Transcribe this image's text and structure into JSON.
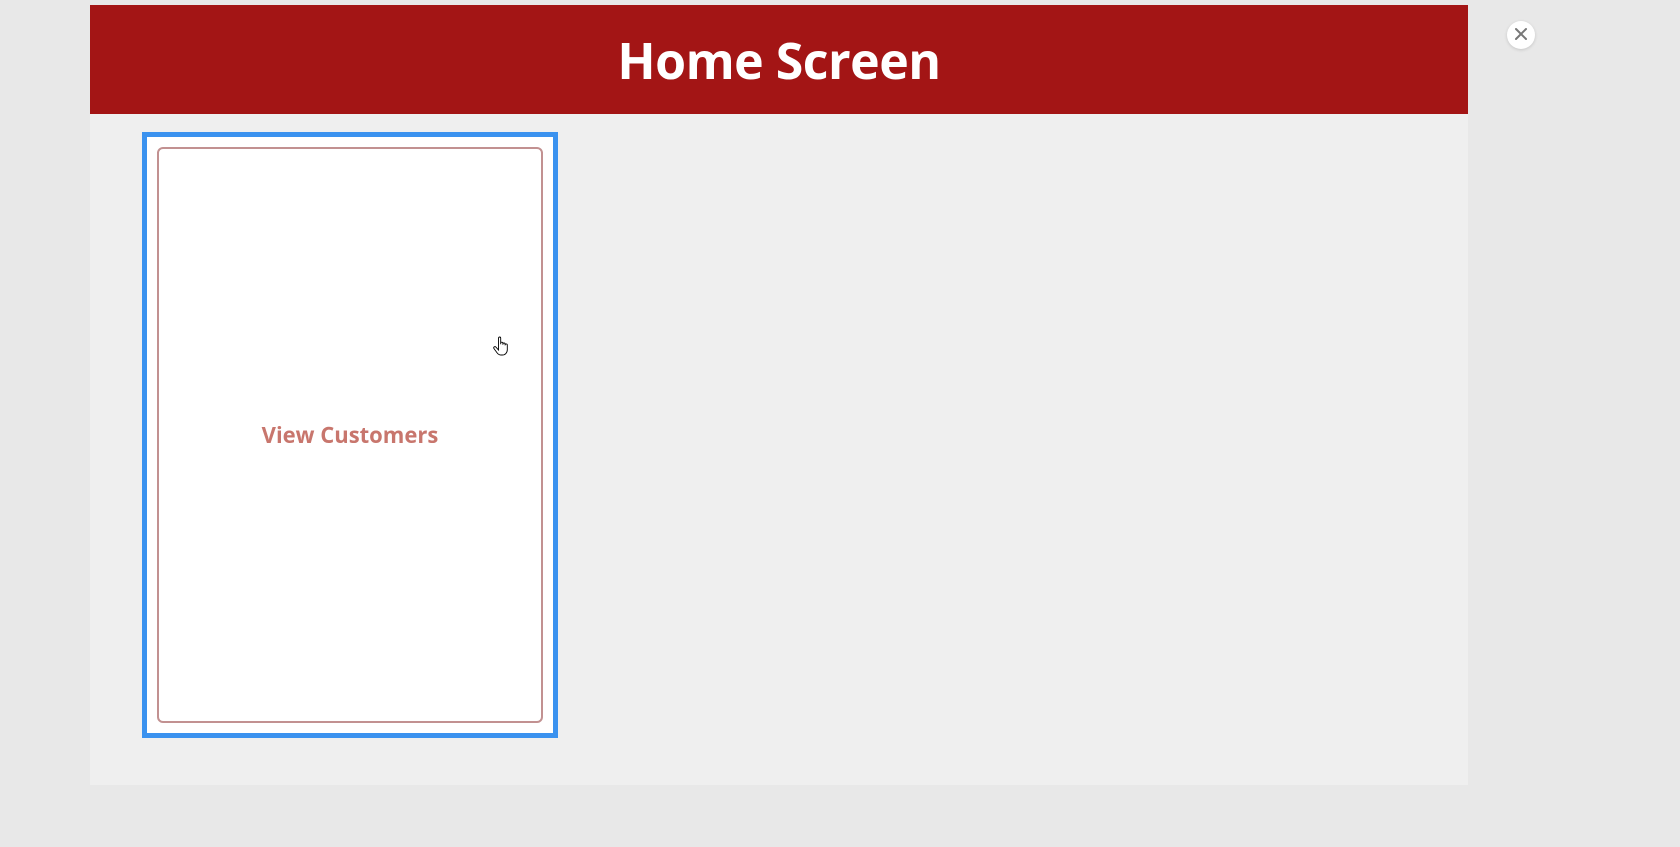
{
  "header": {
    "title": "Home Screen"
  },
  "cards": [
    {
      "label": "View Customers"
    }
  ],
  "colors": {
    "header_bg": "#a31515",
    "card_outer_border": "#3b92ef",
    "card_inner_border": "#c29191",
    "card_label": "#c8766d"
  }
}
